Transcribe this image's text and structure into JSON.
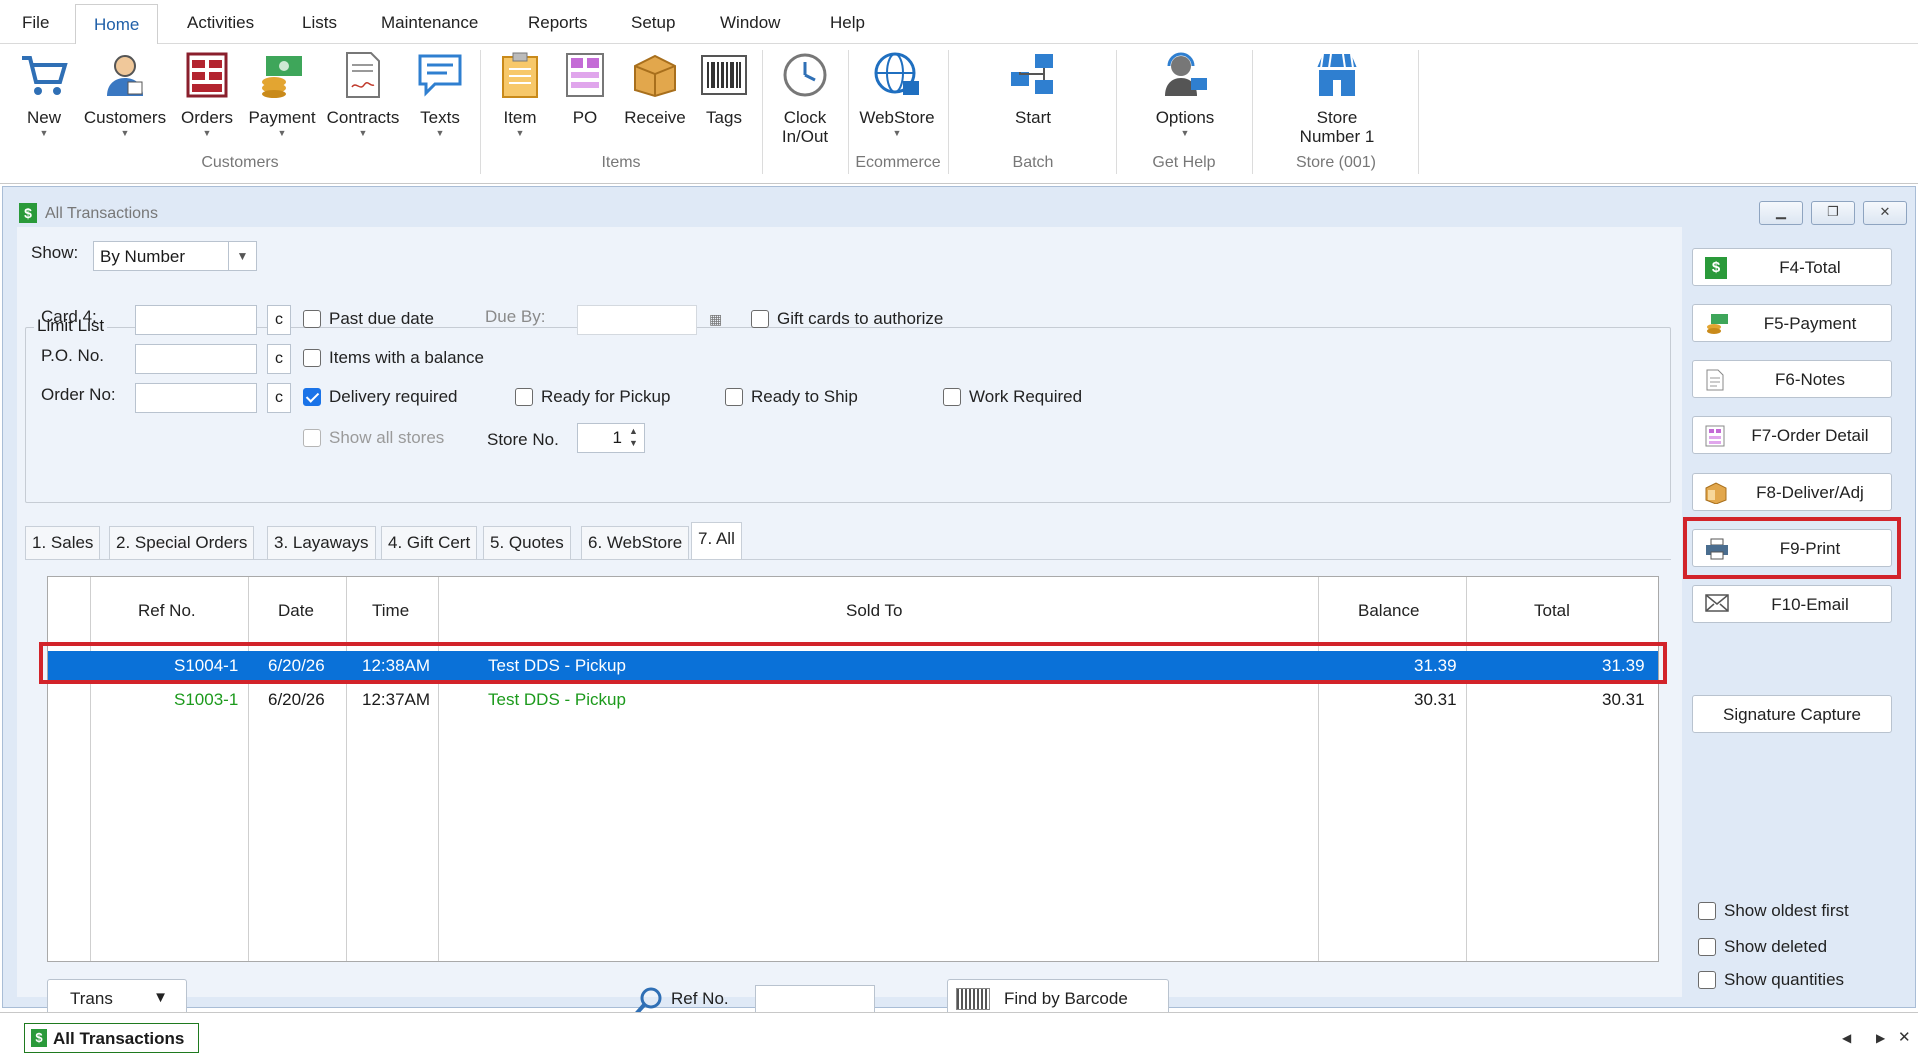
{
  "menu": [
    "File",
    "Home",
    "Activities",
    "Lists",
    "Maintenance",
    "Reports",
    "Setup",
    "Window",
    "Help"
  ],
  "ribbon": {
    "buttons": [
      {
        "label": "New",
        "icon": "cart-icon"
      },
      {
        "label": "Customers",
        "icon": "customer-icon"
      },
      {
        "label": "Orders",
        "icon": "orders-icon"
      },
      {
        "label": "Payment",
        "icon": "payment-icon"
      },
      {
        "label": "Contracts",
        "icon": "contract-icon"
      },
      {
        "label": "Texts",
        "icon": "chat-icon"
      },
      {
        "label": "Item",
        "icon": "clipboard-icon"
      },
      {
        "label": "PO",
        "icon": "po-icon"
      },
      {
        "label": "Receive",
        "icon": "box-icon"
      },
      {
        "label": "Tags",
        "icon": "barcode-icon"
      },
      {
        "label": "Clock\nIn/Out",
        "icon": "clock-icon"
      },
      {
        "label": "WebStore",
        "icon": "globe-icon"
      },
      {
        "label": "Start",
        "icon": "network-icon"
      },
      {
        "label": "Options",
        "icon": "support-icon"
      },
      {
        "label": "Store\nNumber 1",
        "icon": "store-icon"
      }
    ],
    "groups": [
      "Customers",
      "Items",
      "Ecommerce",
      "Batch",
      "Get Help",
      "Store (001)"
    ]
  },
  "window": {
    "title": "All Transactions",
    "show_label": "Show:",
    "show_value": "By Number",
    "limit_list_caption": "Limit List",
    "card4_label": "Card 4:",
    "po_label": "P.O. No.",
    "order_label": "Order No:",
    "c_label": "c",
    "due_by_label": "Due By:",
    "store_no_label": "Store No.",
    "store_no_value": "1",
    "checkboxes": {
      "past_due": "Past due date",
      "gift_cards": "Gift cards to authorize",
      "items_balance": "Items with a balance",
      "delivery_required": "Delivery required",
      "ready_pickup": "Ready for Pickup",
      "ready_ship": "Ready to Ship",
      "work_required": "Work Required",
      "show_all_stores": "Show all stores"
    },
    "tabs": [
      "1. Sales",
      "2. Special Orders",
      "3. Layaways",
      "4. Gift Cert",
      "5. Quotes",
      "6. WebStore",
      "7. All"
    ],
    "active_tab": "7. All",
    "columns": [
      "Ref No.",
      "Date",
      "Time",
      "Sold To",
      "Balance",
      "Total"
    ],
    "rows": [
      {
        "ref": "S1004-1",
        "date": "6/20/26",
        "time": "12:38AM",
        "sold_to": "Test DDS - Pickup",
        "balance": "31.39",
        "total": "31.39"
      },
      {
        "ref": "S1003-1",
        "date": "6/20/26",
        "time": "12:37AM",
        "sold_to": "Test DDS - Pickup",
        "balance": "30.31",
        "total": "30.31"
      }
    ],
    "trans_button": "Trans",
    "ref_search_label": "Ref No.",
    "find_barcode_button": "Find by Barcode"
  },
  "side_buttons": [
    "F4-Total",
    "F5-Payment",
    "F6-Notes",
    "F7-Order Detail",
    "F8-Deliver/Adj",
    "F9-Print",
    "F10-Email",
    "Signature Capture"
  ],
  "side_checks": [
    "Show oldest first",
    "Show deleted",
    "Show quantities"
  ],
  "taskbar": {
    "item": "All Transactions"
  },
  "colors": {
    "accent": "#0a71d8",
    "highlight": "#d2232a",
    "green_text": "#1c9a1c"
  }
}
